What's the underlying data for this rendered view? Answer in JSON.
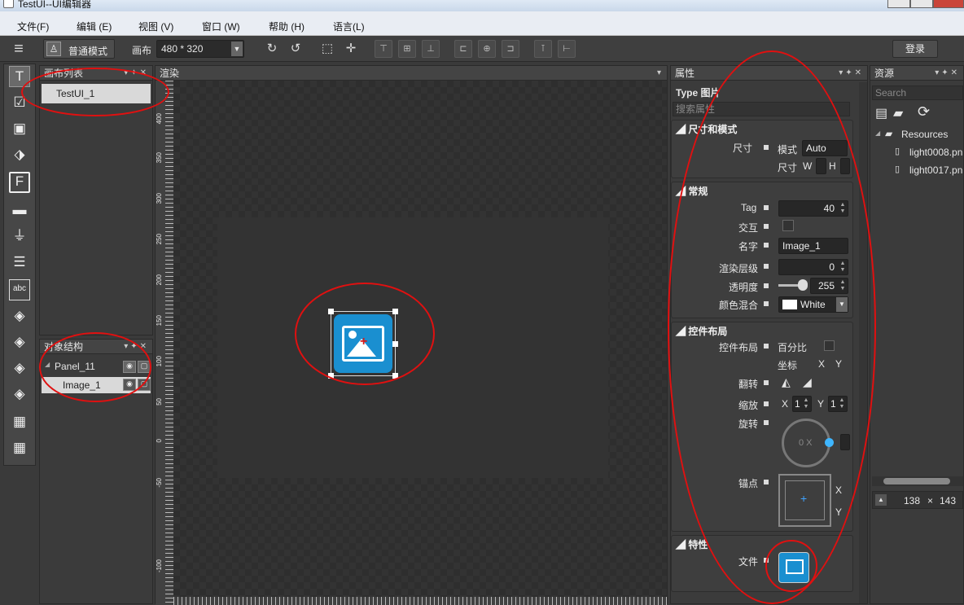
{
  "window": {
    "title": "TestUI--UI编辑器"
  },
  "menu": [
    "文件(F)",
    "编辑 (E)",
    "视图 (V)",
    "窗口 (W)",
    "帮助 (H)",
    "语言(L)"
  ],
  "toolbar": {
    "mode": "普通模式",
    "canvas_label": "画布",
    "canvas_size": "480 * 320",
    "login": "登录"
  },
  "panels": {
    "canvas_list": {
      "title": "画布列表",
      "items": [
        "TestUI_1"
      ]
    },
    "object_tree": {
      "title": "对象结构",
      "items": [
        "Panel_11",
        "Image_1"
      ]
    },
    "render": {
      "title": "渲染"
    },
    "properties": {
      "title": "属性"
    },
    "resources": {
      "title": "资源"
    }
  },
  "props": {
    "type_label": "Type",
    "type_value": "图片",
    "search_placeholder": "搜索属性",
    "size_section": "尺寸和模式",
    "size_label": "尺寸",
    "mode_label": "模式",
    "mode_value": "Auto",
    "size2_label": "尺寸",
    "w": "W",
    "h": "H",
    "general_section": "常规",
    "tag_label": "Tag",
    "tag_value": "40",
    "interact_label": "交互",
    "name_label": "名字",
    "name_value": "Image_1",
    "layer_label": "渲染层级",
    "layer_value": "0",
    "alpha_label": "透明度",
    "alpha_value": "255",
    "alpha_level": 1.0,
    "blend_label": "颜色混合",
    "blend_value": "White",
    "layout_section": "控件布局",
    "layout_label": "控件布局",
    "percent_label": "百分比",
    "coord_label": "坐标",
    "x": "X",
    "y": "Y",
    "flip_label": "翻转",
    "scale_label": "缩放",
    "scale_x": "1",
    "scale_y": "1",
    "rotate_label": "旋转",
    "rotate_value": "0 X",
    "anchor_label": "锚点",
    "feature_section": "特性",
    "file_label": "文件"
  },
  "resources": {
    "search_placeholder": "Search",
    "folder": "Resources",
    "files": [
      "light0008.pn",
      "light0017.pn"
    ],
    "size": "138",
    "times": "×",
    "size2": "143"
  },
  "ruler_v": [
    "400",
    "350",
    "300",
    "250",
    "200",
    "150",
    "100",
    "50",
    "0",
    "-50",
    "-100"
  ],
  "colors": {
    "accent": "#1a8fd0",
    "annotation": "#e01010"
  }
}
